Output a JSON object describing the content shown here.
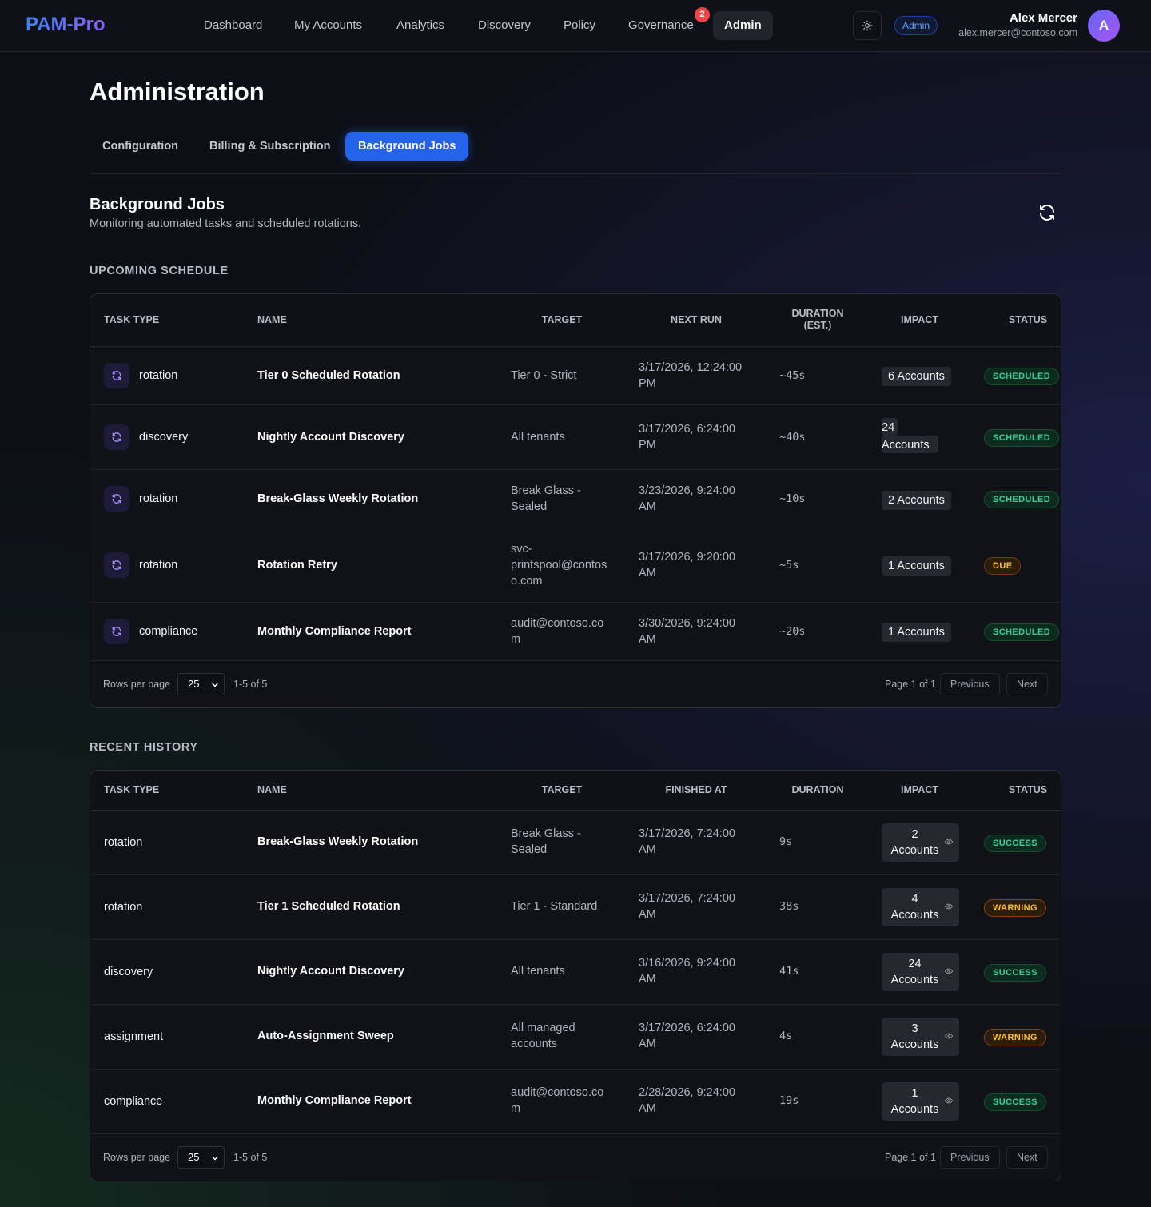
{
  "app": {
    "logo": "PAM-Pro",
    "nav": [
      {
        "label": "Dashboard"
      },
      {
        "label": "My Accounts"
      },
      {
        "label": "Analytics"
      },
      {
        "label": "Discovery"
      },
      {
        "label": "Policy"
      },
      {
        "label": "Governance",
        "badge": "2"
      },
      {
        "label": "Admin",
        "active": true
      }
    ],
    "role_pill": "Admin",
    "user": {
      "name": "Alex Mercer",
      "email": "alex.mercer@contoso.com",
      "initial": "A"
    }
  },
  "page": {
    "title": "Administration",
    "tabs": [
      {
        "label": "Configuration"
      },
      {
        "label": "Billing & Subscription"
      },
      {
        "label": "Background Jobs",
        "active": true
      }
    ],
    "section_title": "Background Jobs",
    "section_subtitle": "Monitoring automated tasks and scheduled rotations."
  },
  "upcoming": {
    "label": "UPCOMING SCHEDULE",
    "headers": {
      "task_type": "TASK TYPE",
      "name": "NAME",
      "target": "TARGET",
      "next_run": "NEXT RUN",
      "duration_1": "DURATION",
      "duration_2": "(EST.)",
      "impact": "IMPACT",
      "status": "STATUS"
    },
    "rows": [
      {
        "type": "rotation",
        "name": "Tier 0 Scheduled Rotation",
        "target_1": "Tier 0 - Strict",
        "target_2": "",
        "target_3": "",
        "run_1": "3/17/2026, 12:24:00",
        "run_2": "PM",
        "duration": "~45s",
        "impact_1": "6 Accounts",
        "impact_2": "",
        "status": "SCHEDULED"
      },
      {
        "type": "discovery",
        "name": "Nightly Account Discovery",
        "target_1": "All tenants",
        "target_2": "",
        "target_3": "",
        "run_1": "3/17/2026, 6:24:00",
        "run_2": "PM",
        "duration": "~40s",
        "impact_1": "24",
        "impact_2": "Accounts",
        "status": "SCHEDULED"
      },
      {
        "type": "rotation",
        "name": "Break-Glass Weekly Rotation",
        "target_1": "Break Glass -",
        "target_2": "Sealed",
        "target_3": "",
        "run_1": "3/23/2026, 9:24:00",
        "run_2": "AM",
        "duration": "~10s",
        "impact_1": "2 Accounts",
        "impact_2": "",
        "status": "SCHEDULED"
      },
      {
        "type": "rotation",
        "name": "Rotation Retry",
        "target_1": "svc-",
        "target_2": "printspool@contos",
        "target_3": "o.com",
        "run_1": "3/17/2026, 9:20:00",
        "run_2": "AM",
        "duration": "~5s",
        "impact_1": "1 Accounts",
        "impact_2": "",
        "status": "DUE"
      },
      {
        "type": "compliance",
        "name": "Monthly Compliance Report",
        "target_1": "audit@contoso.co",
        "target_2": "m",
        "target_3": "",
        "run_1": "3/30/2026, 9:24:00",
        "run_2": "AM",
        "duration": "~20s",
        "impact_1": "1 Accounts",
        "impact_2": "",
        "status": "SCHEDULED"
      }
    ],
    "pager": {
      "rows_label": "Rows per page",
      "rows_value": "25",
      "range": "1-5 of 5",
      "page": "Page 1 of 1",
      "prev": "Previous",
      "next": "Next"
    }
  },
  "history": {
    "label": "RECENT HISTORY",
    "headers": {
      "task_type": "TASK TYPE",
      "name": "NAME",
      "target": "TARGET",
      "finished": "FINISHED AT",
      "duration": "DURATION",
      "impact": "IMPACT",
      "status": "STATUS"
    },
    "rows": [
      {
        "type": "rotation",
        "name": "Break-Glass Weekly Rotation",
        "target_1": "Break Glass -",
        "target_2": "Sealed",
        "fin_1": "3/17/2026, 7:24:00",
        "fin_2": "AM",
        "duration": "9s",
        "impact_1": "2",
        "impact_2": "Accounts",
        "status": "SUCCESS"
      },
      {
        "type": "rotation",
        "name": "Tier 1 Scheduled Rotation",
        "target_1": "Tier 1 - Standard",
        "target_2": "",
        "fin_1": "3/17/2026, 7:24:00",
        "fin_2": "AM",
        "duration": "38s",
        "impact_1": "4",
        "impact_2": "Accounts",
        "status": "WARNING"
      },
      {
        "type": "discovery",
        "name": "Nightly Account Discovery",
        "target_1": "All tenants",
        "target_2": "",
        "fin_1": "3/16/2026, 9:24:00",
        "fin_2": "AM",
        "duration": "41s",
        "impact_1": "24",
        "impact_2": "Accounts",
        "status": "SUCCESS"
      },
      {
        "type": "assignment",
        "name": "Auto-Assignment Sweep",
        "target_1": "All managed",
        "target_2": "accounts",
        "fin_1": "3/17/2026, 6:24:00",
        "fin_2": "AM",
        "duration": "4s",
        "impact_1": "3",
        "impact_2": "Accounts",
        "status": "WARNING"
      },
      {
        "type": "compliance",
        "name": "Monthly Compliance Report",
        "target_1": "audit@contoso.co",
        "target_2": "m",
        "fin_1": "2/28/2026, 9:24:00",
        "fin_2": "AM",
        "duration": "19s",
        "impact_1": "1",
        "impact_2": "Accounts",
        "status": "SUCCESS"
      }
    ],
    "pager": {
      "rows_label": "Rows per page",
      "rows_value": "25",
      "range": "1-5 of 5",
      "page": "Page 1 of 1",
      "prev": "Previous",
      "next": "Next"
    }
  },
  "colors": {
    "accent": "#2563eb",
    "success": "#34d399",
    "warning": "#fbbf24",
    "badge_red": "#ef4444"
  },
  "icons": {
    "theme": "sun-icon",
    "refresh": "refresh-icon",
    "task": "rotate-icon",
    "impact": "eye-icon",
    "select": "chevron-down-icon"
  }
}
